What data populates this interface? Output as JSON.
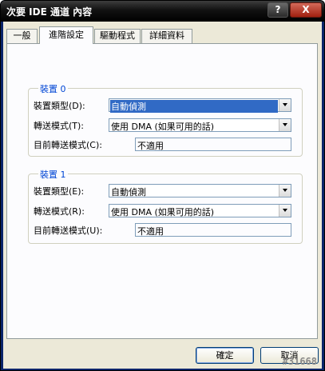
{
  "window": {
    "title": "次要 IDE 通道 內容",
    "help_label": "?",
    "close_label": "X"
  },
  "tabs": [
    {
      "label": "一般",
      "active": false
    },
    {
      "label": "進階設定",
      "active": true
    },
    {
      "label": "驅動程式",
      "active": false
    },
    {
      "label": "詳細資料",
      "active": false
    }
  ],
  "device0": {
    "title": "裝置 0",
    "type_label": "裝置類型(D):",
    "type_value": "自動偵測",
    "transfer_label": "轉送模式(T):",
    "transfer_value": "使用 DMA (如果可用的話)",
    "current_label": "目前轉送模式(C):",
    "current_value": "不適用"
  },
  "device1": {
    "title": "裝置 1",
    "type_label": "裝置類型(E):",
    "type_value": "自動偵測",
    "transfer_label": "轉送模式(R):",
    "transfer_value": "使用 DMA (如果可用的話)",
    "current_label": "目前轉送模式(U):",
    "current_value": "不適用"
  },
  "buttons": {
    "ok": "確定",
    "cancel": "取消"
  },
  "watermark": "#31668"
}
